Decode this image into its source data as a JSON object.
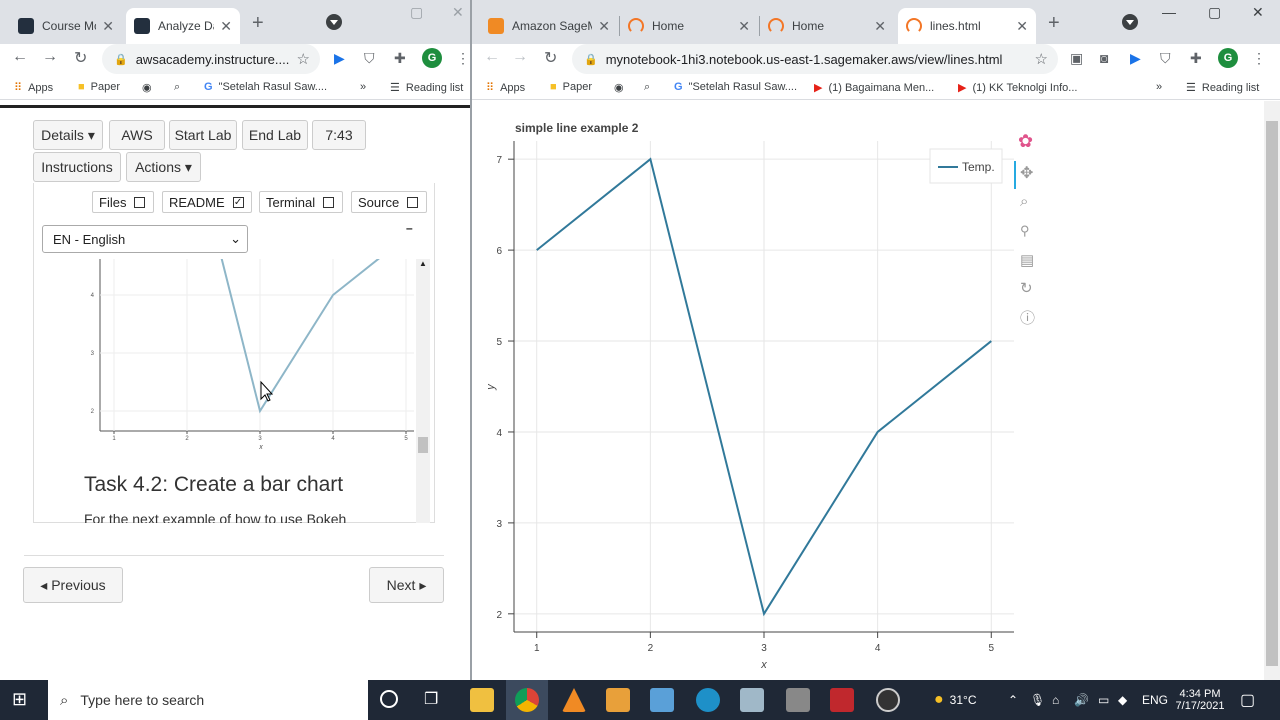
{
  "left_browser": {
    "tabs": [
      {
        "title": "Course Mc",
        "active": false
      },
      {
        "title": "Analyze Da",
        "active": true
      }
    ],
    "url": "awsacademy.instructure....",
    "bookmarks": [
      "Apps",
      "Paper",
      "\"Setelah Rasul Saw....",
      "Reading list"
    ],
    "lab": {
      "buttons": [
        "Details ▾",
        "AWS",
        "Start Lab",
        "End Lab",
        "7:43"
      ],
      "buttons2": [
        "Instructions",
        "Actions ▾"
      ],
      "checkboxes": [
        {
          "label": "Files",
          "checked": false
        },
        {
          "label": "README",
          "checked": true
        },
        {
          "label": "Terminal",
          "checked": false
        },
        {
          "label": "Source",
          "checked": false
        }
      ],
      "language": "EN - English",
      "minimize": "–",
      "heading": "Task 4.2: Create a bar chart",
      "paragraph": "For the next example of how to use Bokeh",
      "thumb_x_ticks": [
        "1",
        "2",
        "3",
        "4",
        "5"
      ],
      "thumb_y_ticks": [
        "4",
        "3",
        "2"
      ],
      "thumb_xlabel": "x"
    },
    "prev_label": "◂ Previous",
    "next_label": "Next ▸"
  },
  "right_browser": {
    "tabs": [
      {
        "title": "Amazon SageM",
        "active": false
      },
      {
        "title": "Home",
        "active": false
      },
      {
        "title": "Home",
        "active": false
      },
      {
        "title": "lines.html",
        "active": true
      }
    ],
    "url": "mynotebook-1hi3.notebook.us-east-1.sagemaker.aws/view/lines.html",
    "bookmarks": [
      "Apps",
      "Paper",
      "\"Setelah Rasul Saw....",
      "(1) Bagaimana Men...",
      "(1) KK Teknolgi Info...",
      "Reading list"
    ],
    "profile_initial": "G"
  },
  "taskbar": {
    "search_placeholder": "Type here to search",
    "weather": "31°C",
    "lang": "ENG",
    "time": "4:34 PM",
    "date": "7/17/2021"
  },
  "chart_data": {
    "type": "line",
    "title": "simple line example 2",
    "xlabel": "x",
    "ylabel": "y",
    "x": [
      1,
      2,
      3,
      4,
      5
    ],
    "series": [
      {
        "name": "Temp.",
        "values": [
          6,
          7,
          2,
          4,
          5
        ]
      }
    ],
    "xlim": [
      0.8,
      5.2
    ],
    "ylim": [
      1.8,
      7.2
    ],
    "xticks": [
      1,
      2,
      3,
      4,
      5
    ],
    "yticks": [
      2,
      3,
      4,
      5,
      6,
      7
    ],
    "grid": true,
    "legend_position": "top-right",
    "line_color": "#31799a"
  }
}
